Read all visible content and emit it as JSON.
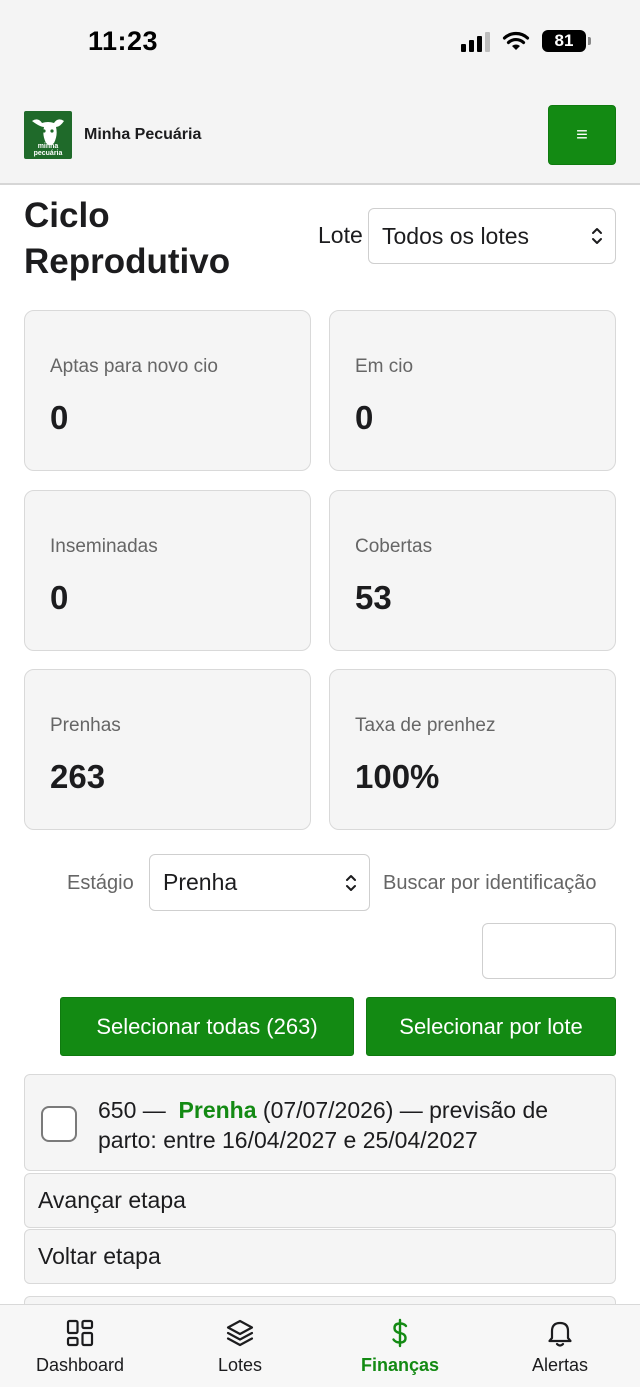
{
  "status_bar": {
    "time": "11:23",
    "battery": "81"
  },
  "header": {
    "app_name": "Minha Pecuária",
    "logo_text": "minha pecuária",
    "menu_icon": "≡"
  },
  "page": {
    "title": "Ciclo Reprodutivo"
  },
  "lote_filter": {
    "label": "Lote",
    "selected": "Todos os lotes"
  },
  "stats": [
    {
      "label": "Aptas para novo cio",
      "value": "0"
    },
    {
      "label": "Em cio",
      "value": "0"
    },
    {
      "label": "Inseminadas",
      "value": "0"
    },
    {
      "label": "Cobertas",
      "value": "53"
    },
    {
      "label": "Prenhas",
      "value": "263"
    },
    {
      "label": "Taxa de prenhez",
      "value": "100%"
    }
  ],
  "filters": {
    "estagio_label": "Estágio",
    "estagio_selected": "Prenha",
    "search_label": "Buscar por identificação",
    "search_value": ""
  },
  "actions": {
    "select_all": "Selecionar todas (263)",
    "select_by_lote": "Selecionar por lote"
  },
  "list": {
    "items": [
      {
        "id": "650 —",
        "stage": "Prenha",
        "details": "(07/07/2026) — previsão de parto: entre 16/04/2027 e 25/04/2027",
        "checked": false
      }
    ],
    "advance_label": "Avançar etapa",
    "back_label": "Voltar etapa"
  },
  "bottom_nav": [
    {
      "label": "Dashboard",
      "icon": "dashboard-icon",
      "active": false
    },
    {
      "label": "Lotes",
      "icon": "layers-icon",
      "active": false
    },
    {
      "label": "Finanças",
      "icon": "dollar-icon",
      "active": true
    },
    {
      "label": "Alertas",
      "icon": "bell-icon",
      "active": false
    }
  ],
  "colors": {
    "primary": "#138a13",
    "card_bg": "#f5f5f5",
    "border": "#d9d9d9"
  }
}
